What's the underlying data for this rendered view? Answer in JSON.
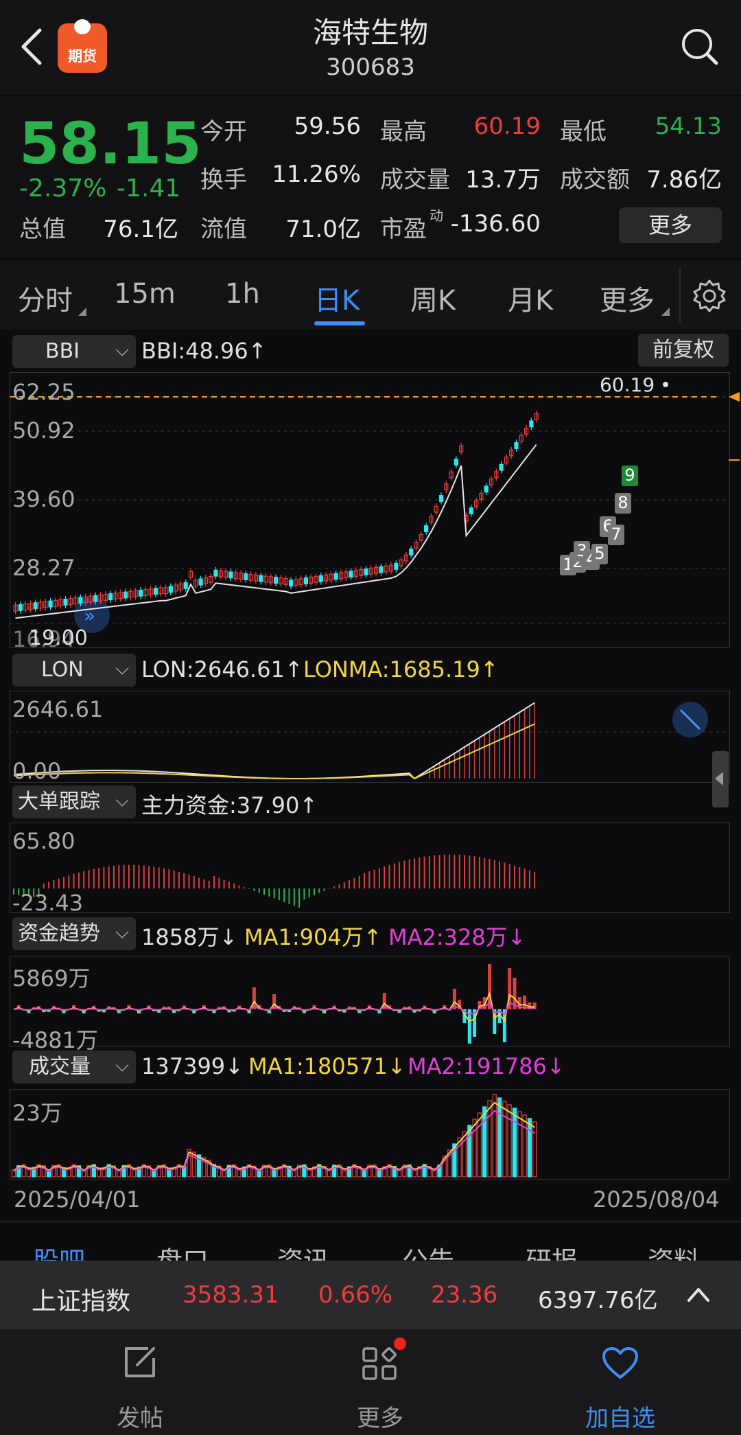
{
  "header": {
    "title": "海特生物",
    "code": "300683",
    "logo_text": "期货"
  },
  "quote": {
    "price": "58.15",
    "change_pct": "-2.37%",
    "change_abs": "-1.41",
    "rows": [
      [
        {
          "k": "今开",
          "v": "59.56",
          "c": "n"
        },
        {
          "k": "最高",
          "v": "60.19",
          "c": "r"
        },
        {
          "k": "最低",
          "v": "54.13",
          "c": "g"
        }
      ],
      [
        {
          "k": "换手",
          "v": "11.26%",
          "c": "n"
        },
        {
          "k": "成交量",
          "v": "13.7万",
          "c": "n"
        },
        {
          "k": "成交额",
          "v": "7.86亿",
          "c": "n"
        }
      ]
    ],
    "total_value_label": "总值",
    "total_value": "76.1亿",
    "float_label": "流值",
    "float_value": "71.0亿",
    "pe_label": "市盈",
    "pe_sup": "动",
    "pe_value": "-136.60",
    "more_label": "更多"
  },
  "tabs": {
    "items": [
      "分时",
      "15m",
      "1h",
      "日K",
      "周K",
      "月K",
      "更多"
    ],
    "active": "日K"
  },
  "bbi": {
    "selector": "BBI",
    "readout": "BBI:48.96↑",
    "adjust_label": "前复权",
    "y_labels": [
      "62.25",
      "50.92",
      "39.60",
      "28.27",
      "16.94"
    ],
    "low_marker": "19.00",
    "high_marker": "60.19",
    "td_labels": [
      "1",
      "2",
      "3",
      "4",
      "5",
      "6",
      "7",
      "8",
      "9"
    ]
  },
  "lon": {
    "selector": "LON",
    "readout": "LON:2646.61↑",
    "ma_readout": "LONMA:1685.19↑",
    "y_labels": [
      "2646.61",
      "0.00"
    ]
  },
  "big": {
    "selector": "大单跟踪",
    "readout": "主力资金:37.90↑",
    "y_labels": [
      "65.80",
      "-23.43"
    ]
  },
  "flow": {
    "selector": "资金趋势",
    "readout": "1858万↓",
    "ma1": "MA1:904万↑",
    "ma2": "MA2:328万↓",
    "y_labels": [
      "5869万",
      "-4881万"
    ]
  },
  "vol": {
    "selector": "成交量",
    "readout": "137399↓",
    "ma1": "MA1:180571↓",
    "ma2": "MA2:191786↓",
    "y_labels": [
      "23万"
    ]
  },
  "dates": {
    "start": "2025/04/01",
    "end": "2025/08/04"
  },
  "subtabs": [
    "股吧",
    "盘口",
    "资讯",
    "公告",
    "研报",
    "资料"
  ],
  "index_bar": {
    "name": "上证指数",
    "value": "3583.31",
    "pct": "0.66%",
    "change": "23.36",
    "amount": "6397.76亿"
  },
  "bottom_nav": [
    {
      "label": "发帖",
      "icon": "edit-icon"
    },
    {
      "label": "更多",
      "icon": "apps-icon"
    },
    {
      "label": "加自选",
      "icon": "heart-icon"
    }
  ],
  "colors": {
    "up": "#f03c3c",
    "down": "#2bb24c",
    "accent": "#3f8ef7",
    "cyan": "#29e6f0",
    "yellow": "#f2d63b",
    "magenta": "#e23fd8"
  }
}
